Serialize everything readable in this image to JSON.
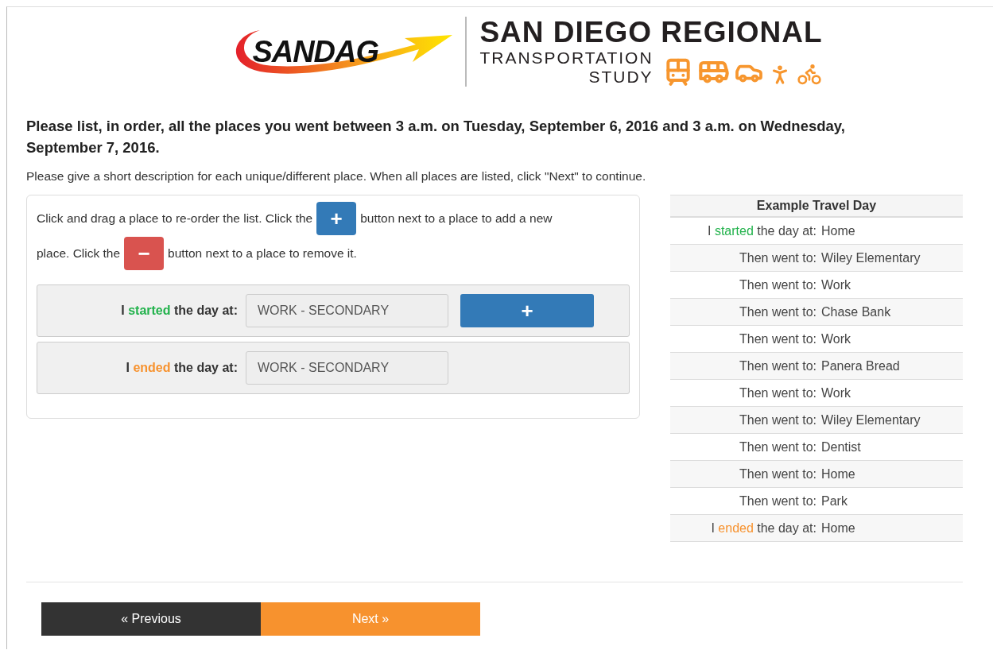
{
  "logo": {
    "brand": "SANDAG",
    "title": "SAN DIEGO REGIONAL",
    "subtitle_1": "TRANSPORTATION",
    "subtitle_2": "STUDY"
  },
  "question": "Please list, in order, all the places you went between 3 a.m. on Tuesday, September 6, 2016 and 3 a.m. on Wednesday, September 7, 2016.",
  "instructions": "Please give a short description for each unique/different place. When all places are listed, click \"Next\" to continue.",
  "help": [
    [
      {
        "kind": "text",
        "text": "Click and drag a place to re-order the list. Click the"
      },
      {
        "kind": "add",
        "text": "+"
      },
      {
        "kind": "text",
        "text": "button next to a place to add a new"
      }
    ],
    [
      {
        "kind": "text",
        "text": "place. Click the"
      },
      {
        "kind": "remove",
        "text": "−"
      },
      {
        "kind": "text",
        "text": "button next to a place to remove it."
      }
    ]
  ],
  "places": [
    {
      "pre": "I ",
      "key": "started",
      "post": " the day at:",
      "kind": "start",
      "value": "WORK - SECONDARY",
      "add_button": "+"
    },
    {
      "pre": "I ",
      "key": "ended",
      "post": " the day at:",
      "kind": "end",
      "value": "WORK - SECONDARY"
    }
  ],
  "example": {
    "title": "Example Travel Day",
    "rows": [
      {
        "kind": "start",
        "pre": "I ",
        "key": "started",
        "post": " the day at:",
        "place": "Home"
      },
      {
        "kind": "then",
        "label": "Then went to:",
        "place": "Wiley Elementary"
      },
      {
        "kind": "then",
        "label": "Then went to:",
        "place": "Work"
      },
      {
        "kind": "then",
        "label": "Then went to:",
        "place": "Chase Bank"
      },
      {
        "kind": "then",
        "label": "Then went to:",
        "place": "Work"
      },
      {
        "kind": "then",
        "label": "Then went to:",
        "place": "Panera Bread"
      },
      {
        "kind": "then",
        "label": "Then went to:",
        "place": "Work"
      },
      {
        "kind": "then",
        "label": "Then went to:",
        "place": "Wiley Elementary"
      },
      {
        "kind": "then",
        "label": "Then went to:",
        "place": "Dentist"
      },
      {
        "kind": "then",
        "label": "Then went to:",
        "place": "Home"
      },
      {
        "kind": "then",
        "label": "Then went to:",
        "place": "Park"
      },
      {
        "kind": "end",
        "pre": "I ",
        "key": "ended",
        "post": " the day at:",
        "place": "Home"
      }
    ]
  },
  "nav": {
    "previous": "« Previous",
    "next": "Next »"
  }
}
